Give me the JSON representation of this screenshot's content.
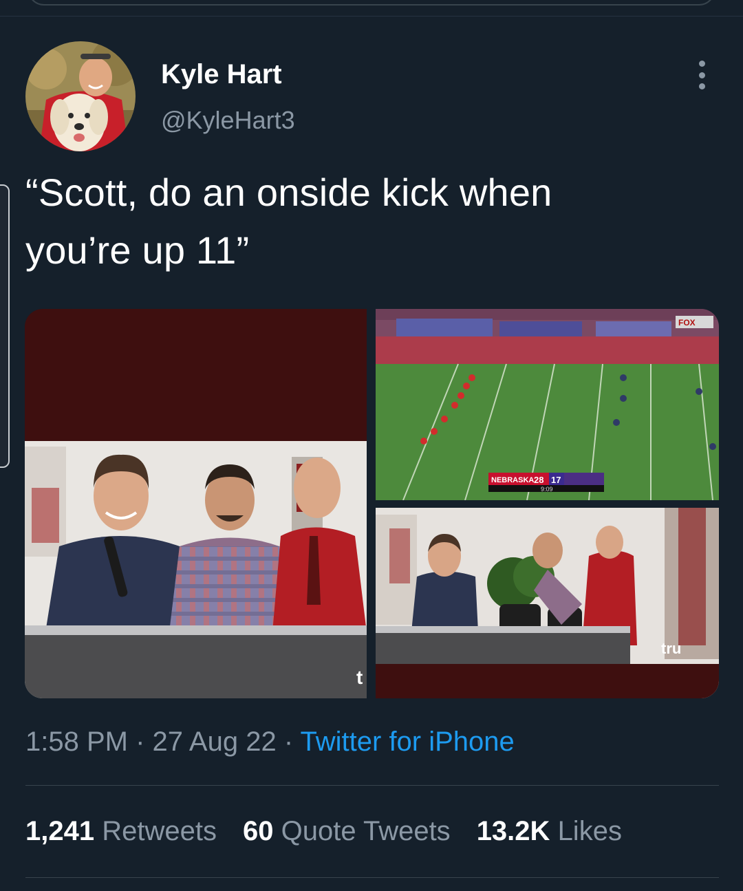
{
  "author": {
    "display_name": "Kyle Hart",
    "handle": "@KyleHart3"
  },
  "tweet": {
    "text_line1": "“Scott, do an onside kick when",
    "text_line2": "you’re up 11”"
  },
  "media": {
    "scoreboard_team1": "NEBRASKA",
    "scoreboard_score1": "28",
    "scoreboard_score2": "17",
    "scoreboard_clock": "9:09",
    "broadcaster": "FOX",
    "network_logo": "tru",
    "corner_mark": "t"
  },
  "meta": {
    "time": "1:58 PM",
    "separator": " · ",
    "date": "27 Aug 22",
    "source": "Twitter for iPhone"
  },
  "stats": {
    "retweets_count": "1,241",
    "retweets_label": "Retweets",
    "quotes_count": "60",
    "quotes_label": "Quote Tweets",
    "likes_count": "13.2K",
    "likes_label": "Likes"
  },
  "colors": {
    "background": "#15202b",
    "secondary_text": "#8b98a5",
    "link": "#1d9bf0",
    "divider": "#38444d"
  }
}
